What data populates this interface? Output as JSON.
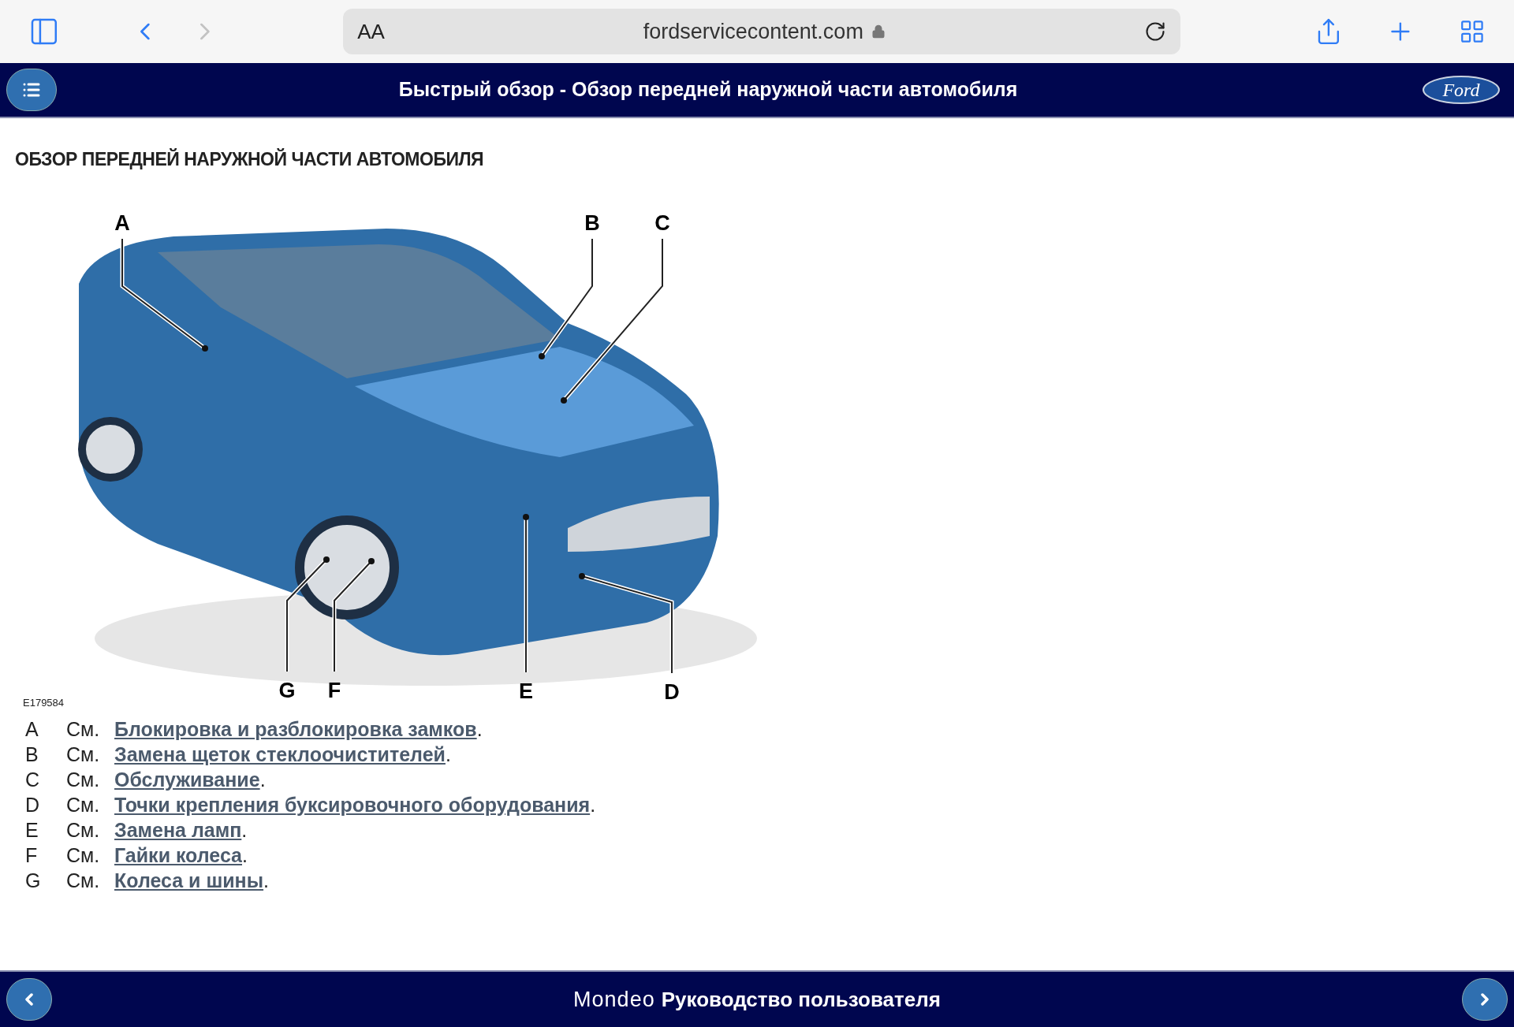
{
  "browser": {
    "text_size": "AA",
    "url": "fordservicecontent.com"
  },
  "header": {
    "title": "Быстрый обзор - Обзор передней наружной части автомобиля",
    "logo": "Ford"
  },
  "heading": "ОБЗОР ПЕРЕДНЕЙ НАРУЖНОЙ ЧАСТИ АВТОМОБИЛЯ",
  "figure": {
    "code": "E179584",
    "callouts": [
      {
        "letter": "A"
      },
      {
        "letter": "B"
      },
      {
        "letter": "C"
      },
      {
        "letter": "G"
      },
      {
        "letter": "F"
      },
      {
        "letter": "E"
      },
      {
        "letter": "D"
      }
    ]
  },
  "legend": [
    {
      "letter": "A",
      "see": "См.",
      "link": "Блокировка и разблокировка замков",
      "end": "."
    },
    {
      "letter": "B",
      "see": "См.",
      "link": "Замена щеток стеклоочистителей",
      "end": "."
    },
    {
      "letter": "C",
      "see": "См.",
      "link": "Обслуживание",
      "end": "."
    },
    {
      "letter": "D",
      "see": "См.",
      "link": "Точки крепления буксировочного оборудования",
      "end": "."
    },
    {
      "letter": "E",
      "see": "См.",
      "link": "Замена ламп",
      "end": "."
    },
    {
      "letter": "F",
      "see": "См.",
      "link": "Гайки колеса",
      "end": "."
    },
    {
      "letter": "G",
      "see": "См.",
      "link": "Колеса и шины",
      "end": "."
    }
  ],
  "footer": {
    "model": "Mondeo",
    "title": "Руководство пользователя"
  }
}
